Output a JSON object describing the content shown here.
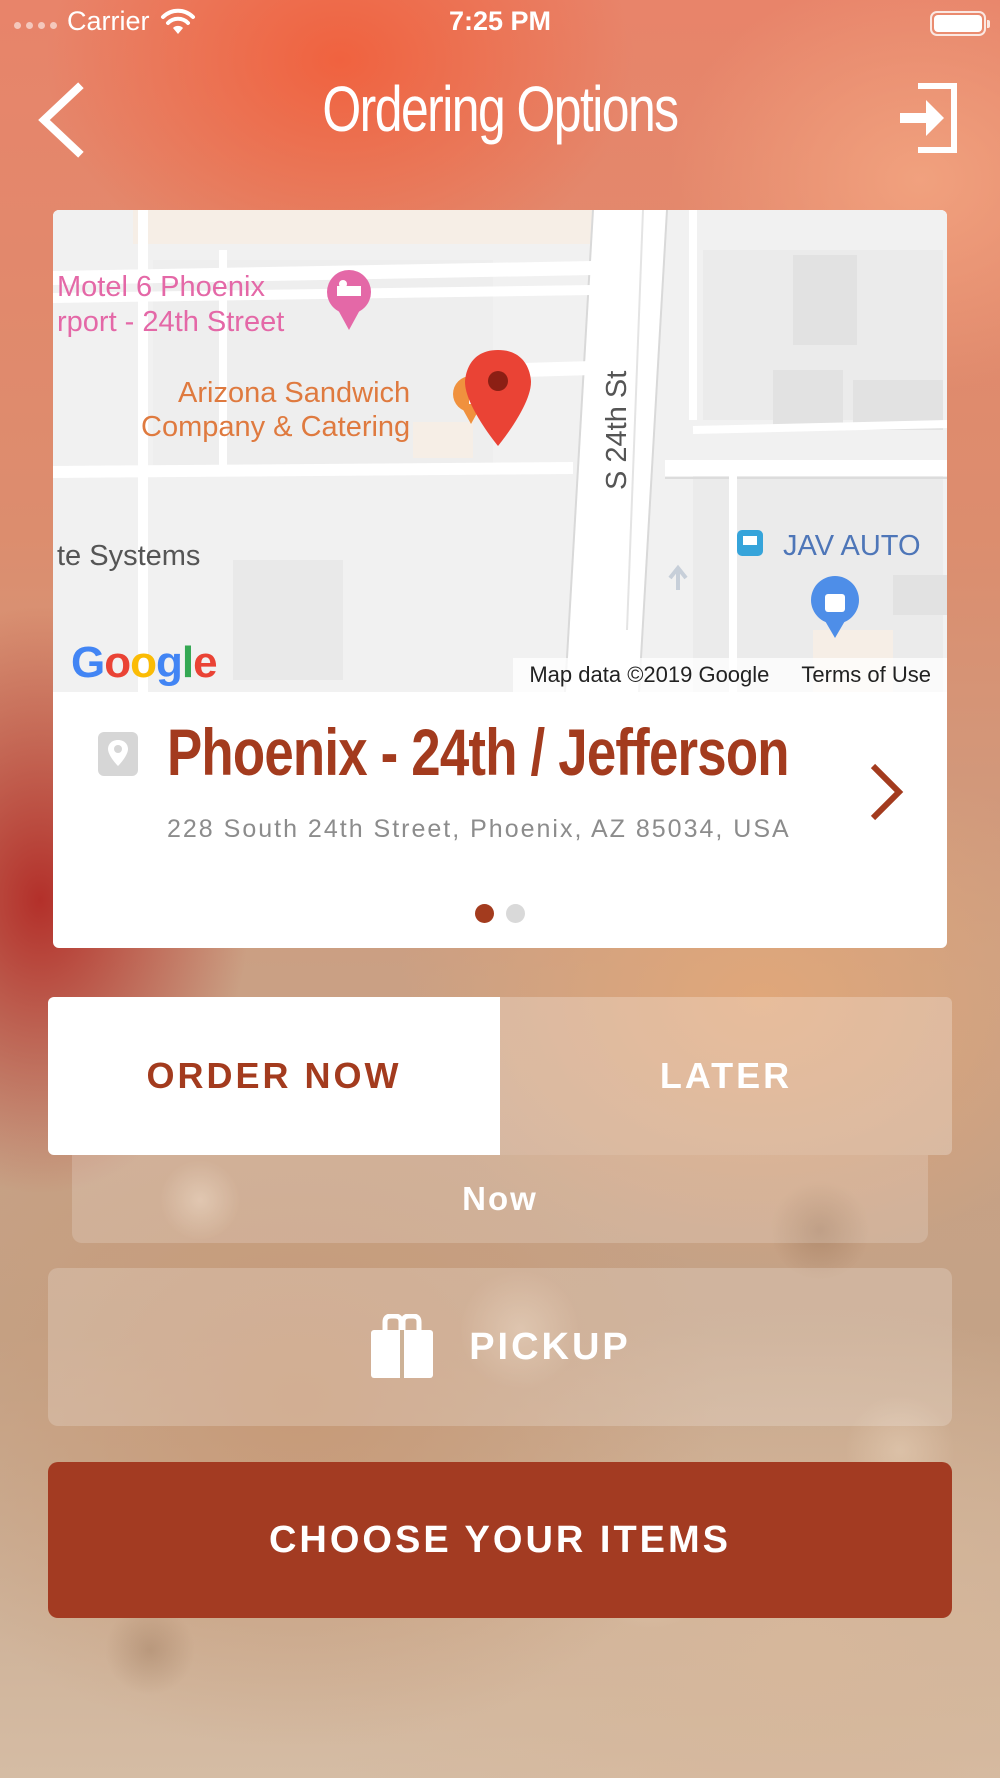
{
  "status_bar": {
    "carrier": "Carrier",
    "time": "7:25 PM"
  },
  "nav": {
    "title": "Ordering Options",
    "back_icon": "chevron-left-icon",
    "logout_icon": "logout-icon"
  },
  "map": {
    "labels": {
      "motel_line1": "Motel 6 Phoenix",
      "motel_line2": "rport - 24th Street",
      "restaurant_line1": "Arizona Sandwich",
      "restaurant_line2": "Company & Catering",
      "street": "S 24th St",
      "systems": "te Systems",
      "auto": "JAV AUTO"
    },
    "logo": "Google",
    "attribution": "Map data ©2019 Google",
    "terms": "Terms of Use"
  },
  "location": {
    "name": "Phoenix - 24th / Jefferson",
    "address": "228 South 24th Street, Phoenix, AZ 85034, USA",
    "page_count": 2,
    "active_page": 1
  },
  "order_timing": {
    "now_label": "ORDER NOW",
    "later_label": "LATER",
    "selected": "ORDER NOW",
    "time_value": "Now"
  },
  "fulfillment": {
    "label": "PICKUP",
    "icon": "shopping-bag-icon"
  },
  "cta": {
    "label": "CHOOSE YOUR ITEMS"
  },
  "colors": {
    "brand": "#a33b22",
    "map_pin": "#ea4335"
  }
}
